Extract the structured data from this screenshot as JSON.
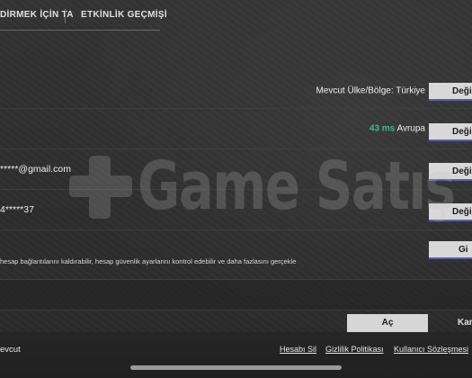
{
  "tabs": [
    {
      "label": "DİRMEK İÇİN TA"
    },
    {
      "label": "ETKİNLİK GEÇMİŞİ"
    }
  ],
  "settings": {
    "region": {
      "label": "Mevcut Ülke/Bölge: Türkiye",
      "button": "Deği"
    },
    "server": {
      "ping": "43 ms",
      "region_name": "Avrupa",
      "button": "Deği"
    },
    "email": {
      "value": "*****@gmail.com",
      "button": "Deği"
    },
    "phone": {
      "value": "4*****37",
      "button": "Deği"
    },
    "security": {
      "description": "hesap bağlantılarını kaldırabilir, hesap güvenlik ayarlarını kontrol edebilir ve daha fazlasını gerçekle",
      "button": "Gi"
    }
  },
  "dialog": {
    "open_label": "Aç",
    "cancel_label": "Kan"
  },
  "footer": {
    "left_text": "evcut",
    "links": [
      "Hesabı Sil",
      "Gizlilik Politikası",
      "Kullanıcı Sözleşmesi"
    ]
  },
  "watermark": {
    "text": "Game Satış"
  }
}
